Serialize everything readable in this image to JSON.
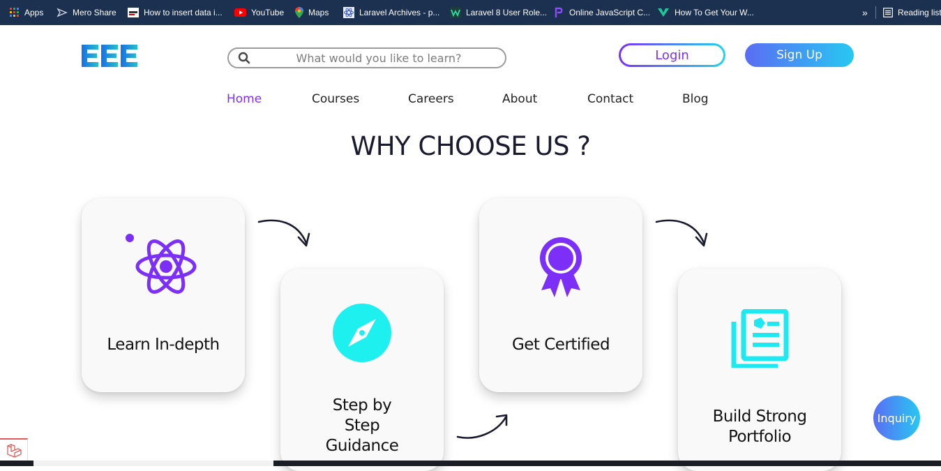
{
  "bookmarks": [
    {
      "label": "Apps",
      "icon": "apps-grid-icon"
    },
    {
      "label": "Mero Share",
      "icon": "mero-share-icon"
    },
    {
      "label": "How to insert data i...",
      "icon": "site-favicon-icon"
    },
    {
      "label": "YouTube",
      "icon": "youtube-icon"
    },
    {
      "label": "Maps",
      "icon": "maps-pin-icon"
    },
    {
      "label": "Laravel Archives - p...",
      "icon": "atom-favicon-icon"
    },
    {
      "label": "Laravel 8 User Role...",
      "icon": "w-favicon-icon"
    },
    {
      "label": "Online JavaScript C...",
      "icon": "p-favicon-icon"
    },
    {
      "label": "How To Get Your W...",
      "icon": "leaf-favicon-icon"
    }
  ],
  "bookmarks_more": "»",
  "reading_list": "Reading list",
  "search": {
    "placeholder": "What would you like to learn?"
  },
  "auth": {
    "login": "Login",
    "signup": "Sign Up"
  },
  "nav": [
    "Home",
    "Courses",
    "Careers",
    "About",
    "Contact",
    "Blog"
  ],
  "section_title": "WHY CHOOSE US ?",
  "cards": [
    {
      "title": "Learn In-depth",
      "icon": "atom-icon"
    },
    {
      "title": "Step by Step Guidance",
      "title_lines": [
        "Step by",
        "Step",
        "Guidance"
      ],
      "icon": "compass-icon"
    },
    {
      "title": "Get Certified",
      "icon": "award-ribbon-icon"
    },
    {
      "title": "Build Strong Portfolio",
      "title_lines": [
        "Build Strong",
        "Portfolio"
      ],
      "icon": "portfolio-icon"
    }
  ],
  "inquiry": "Inquiry",
  "colors": {
    "purple": "#7b2ff7",
    "cyan": "#1ed6e8",
    "bookmark_bar": "#1c3050",
    "heading": "#1a1a2e"
  }
}
